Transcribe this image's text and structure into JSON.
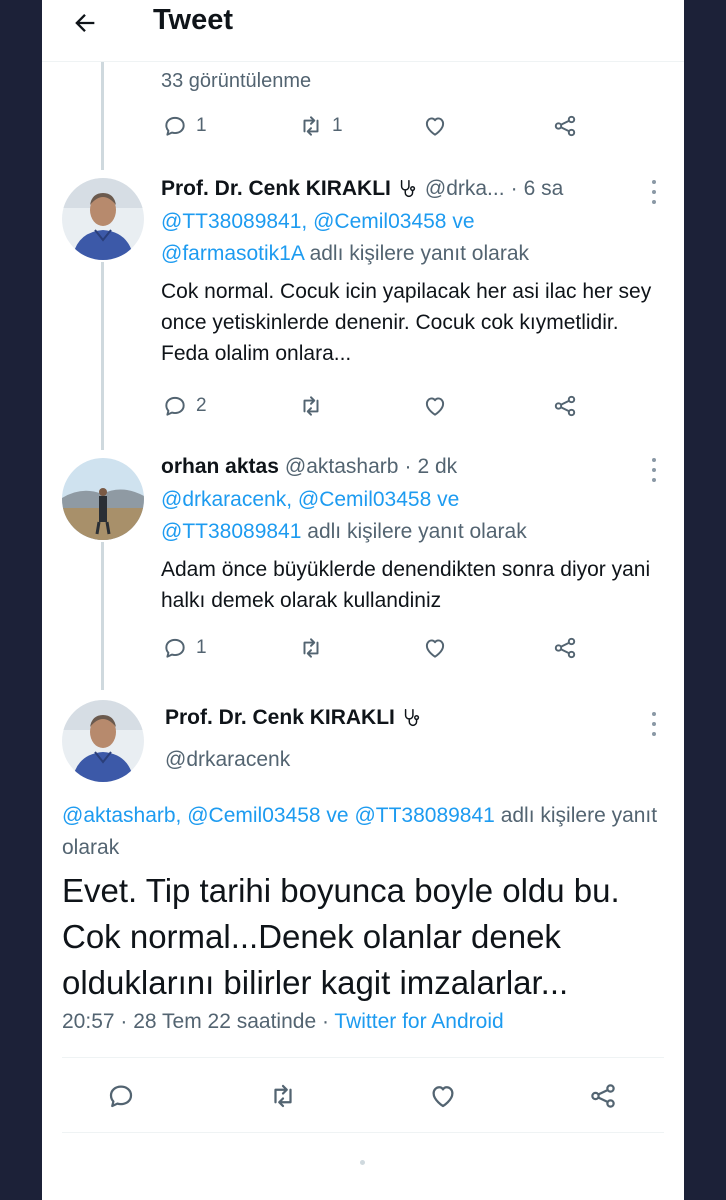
{
  "header": {
    "title": "Tweet"
  },
  "views": "33 görüntülenme",
  "first_actions": {
    "replies": "1",
    "retweets": "1",
    "likes": ""
  },
  "tweets": [
    {
      "name": "Prof. Dr. Cenk KIRAKLI",
      "handle": "@drka...",
      "time": "6 sa",
      "reply_mentions": [
        "@TT38089841,",
        "@Cemil03458",
        "ve",
        "@farmasotik1A"
      ],
      "reply_suffix": "adlı kişilere yanıt olarak",
      "text": "Cok normal. Cocuk icin yapilacak her asi ilac her sey once yetiskinlerde denenir. Cocuk cok kıymetlidir. Feda olalim onlara...",
      "replies": "2",
      "retweets": "",
      "likes": ""
    },
    {
      "name": "orhan aktas",
      "handle": "@aktasharb",
      "time": "2 dk",
      "reply_mentions": [
        "@drkaracenk,",
        "@Cemil03458",
        "ve",
        "@TT38089841"
      ],
      "reply_suffix": "adlı kişilere yanıt olarak",
      "text": "Adam önce büyüklerde denendikten sonra diyor yani halkı demek olarak kullandiniz",
      "replies": "1",
      "retweets": "",
      "likes": ""
    }
  ],
  "main": {
    "name": "Prof. Dr. Cenk KIRAKLI",
    "handle": "@drkaracenk",
    "reply_mentions": "@aktasharb, @Cemil03458 ve @TT38089841",
    "reply_suffix": "adlı kişilere yanıt olarak",
    "text": "Evet. Tip tarihi boyunca boyle oldu bu. Cok normal...Denek olanlar denek olduklarını bilirler kagit imzalarlar...",
    "time": "20:57 · 28 Tem 22 saatinde ·",
    "source": "Twitter for Android"
  },
  "separator": "·",
  "colors": {
    "link": "#1d9bf0",
    "muted": "#536471",
    "text": "#0f1419",
    "background": "#1c2138"
  },
  "icons": [
    "back-arrow-icon",
    "reply-icon",
    "retweet-icon",
    "like-icon",
    "share-icon",
    "stethoscope-icon",
    "more-icon"
  ]
}
